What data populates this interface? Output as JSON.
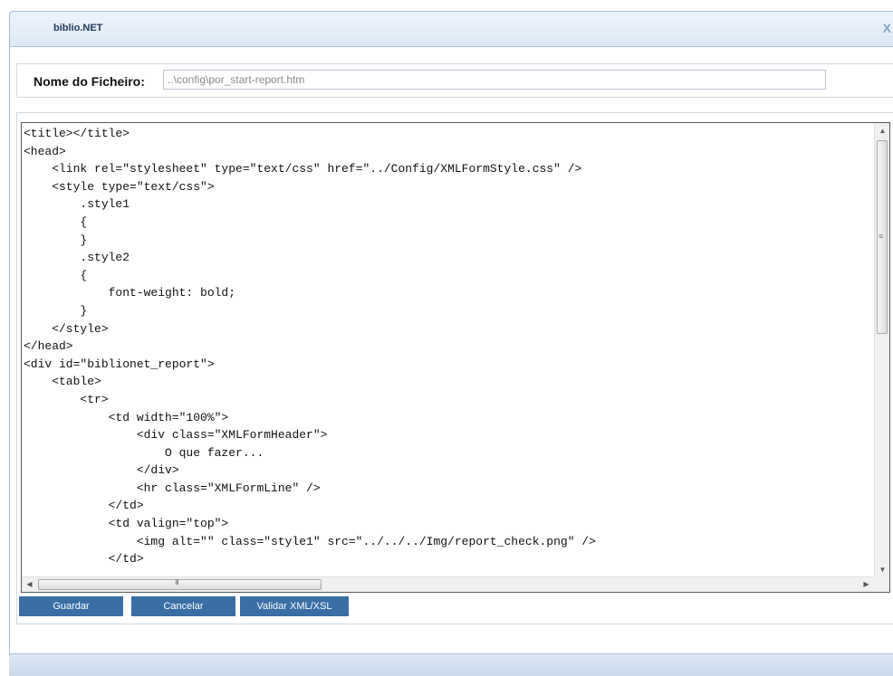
{
  "window": {
    "title": "biblio.NET",
    "close_label": "X"
  },
  "file": {
    "label": "Nome do Ficheiro:",
    "value": "..\\config\\por_start-report.htm"
  },
  "editor": {
    "lines": [
      "<title></title>",
      "<head>",
      "    <link rel=\"stylesheet\" type=\"text/css\" href=\"../Config/XMLFormStyle.css\" />",
      "    <style type=\"text/css\">",
      "        .style1",
      "        {",
      "        }",
      "        .style2",
      "        {",
      "            font-weight: bold;",
      "        }",
      "    </style>",
      "</head>",
      "<div id=\"biblionet_report\">",
      "    <table>",
      "        <tr>",
      "            <td width=\"100%\">",
      "                <div class=\"XMLFormHeader\">",
      "                    O que fazer...",
      "                </div>",
      "                <hr class=\"XMLFormLine\" />",
      "            </td>",
      "            <td valign=\"top\">",
      "                <img alt=\"\" class=\"style1\" src=\"../../../Img/report_check.png\" />",
      "            </td>"
    ]
  },
  "buttons": {
    "save": "Guardar",
    "cancel": "Cancelar",
    "validate": "Validar XML/XSL"
  }
}
